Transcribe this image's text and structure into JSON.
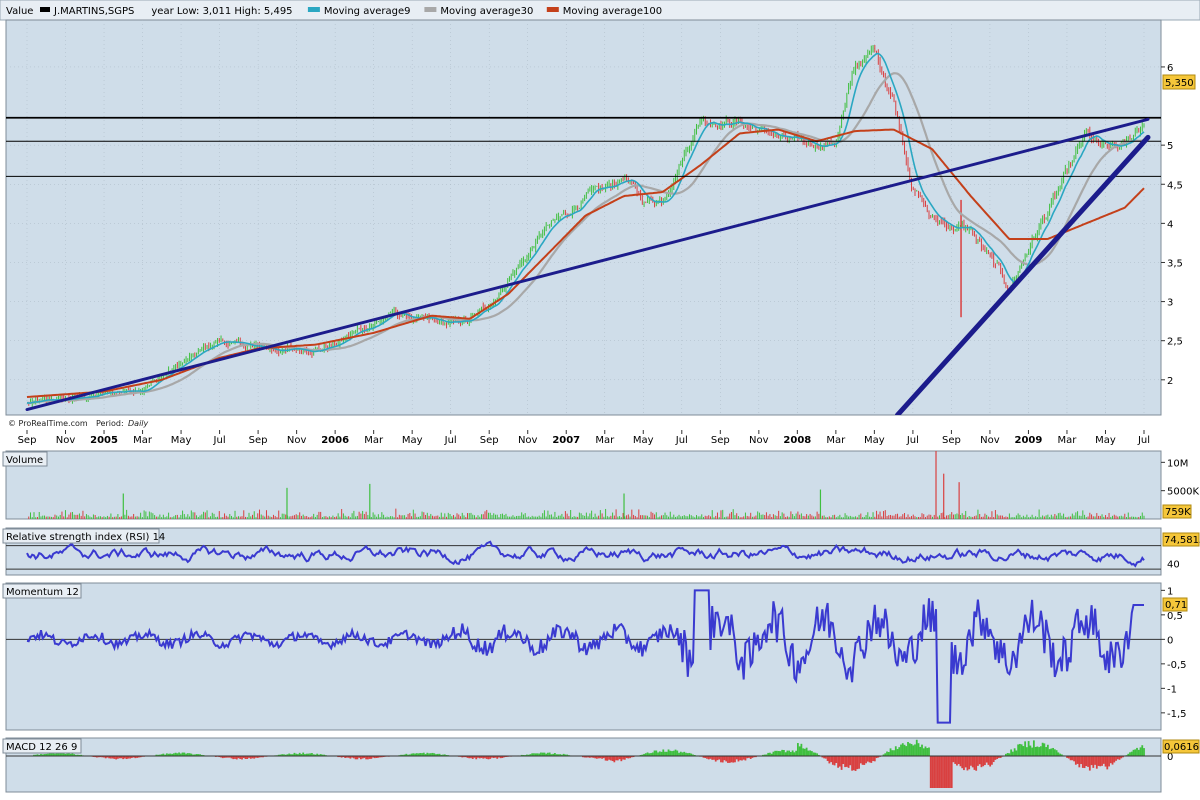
{
  "chart_data": {
    "type": "line",
    "header": {
      "value_label": "Value",
      "symbol": "J.MARTINS,SGPS",
      "range_text": "year Low: 3,011 High: 5,495",
      "legend": [
        {
          "name": "J.MARTINS,SGPS",
          "color": "#000000"
        },
        {
          "name": "Moving average9",
          "color": "#2aa7c2"
        },
        {
          "name": "Moving average30",
          "color": "#a8a8a8"
        },
        {
          "name": "Moving average100",
          "color": "#c4401a"
        }
      ]
    },
    "credit": "© ProRealTime.com",
    "period_label": "Period:",
    "period_value": "Daily",
    "x_ticks": [
      {
        "label": "Sep",
        "bold": false
      },
      {
        "label": "Nov",
        "bold": false
      },
      {
        "label": "2005",
        "bold": true
      },
      {
        "label": "Mar",
        "bold": false
      },
      {
        "label": "May",
        "bold": false
      },
      {
        "label": "Jul",
        "bold": false
      },
      {
        "label": "Sep",
        "bold": false
      },
      {
        "label": "Nov",
        "bold": false
      },
      {
        "label": "2006",
        "bold": true
      },
      {
        "label": "Mar",
        "bold": false
      },
      {
        "label": "May",
        "bold": false
      },
      {
        "label": "Jul",
        "bold": false
      },
      {
        "label": "Sep",
        "bold": false
      },
      {
        "label": "Nov",
        "bold": false
      },
      {
        "label": "2007",
        "bold": true
      },
      {
        "label": "Mar",
        "bold": false
      },
      {
        "label": "May",
        "bold": false
      },
      {
        "label": "Jul",
        "bold": false
      },
      {
        "label": "Sep",
        "bold": false
      },
      {
        "label": "Nov",
        "bold": false
      },
      {
        "label": "2008",
        "bold": true
      },
      {
        "label": "Mar",
        "bold": false
      },
      {
        "label": "May",
        "bold": false
      },
      {
        "label": "Jul",
        "bold": false
      },
      {
        "label": "Sep",
        "bold": false
      },
      {
        "label": "Nov",
        "bold": false
      },
      {
        "label": "2009",
        "bold": true
      },
      {
        "label": "Mar",
        "bold": false
      },
      {
        "label": "May",
        "bold": false
      },
      {
        "label": "Jul",
        "bold": false
      }
    ],
    "price_panel": {
      "ylim": [
        1.55,
        6.6
      ],
      "y_ticks": [
        {
          "v": 2,
          "label": "2"
        },
        {
          "v": 2.5,
          "label": "2,5"
        },
        {
          "v": 3,
          "label": "3"
        },
        {
          "v": 3.5,
          "label": "3,5"
        },
        {
          "v": 4,
          "label": "4"
        },
        {
          "v": 4.5,
          "label": "4,5"
        },
        {
          "v": 5,
          "label": "5"
        },
        {
          "v": 6,
          "label": "6"
        }
      ],
      "last_value_label": "5,350",
      "last_value": 5.35,
      "horizontal_lines": [
        5.35,
        5.05,
        4.6
      ],
      "price_anchors": [
        [
          0,
          1.7
        ],
        [
          2,
          1.74
        ],
        [
          4,
          1.82
        ],
        [
          6,
          1.9
        ],
        [
          8,
          2.2
        ],
        [
          10,
          2.5
        ],
        [
          11,
          2.45
        ],
        [
          12,
          2.4
        ],
        [
          14,
          2.38
        ],
        [
          16,
          2.45
        ],
        [
          17,
          2.6
        ],
        [
          19,
          2.85
        ],
        [
          21,
          2.72
        ],
        [
          22,
          2.7
        ],
        [
          23,
          2.75
        ],
        [
          24,
          2.95
        ],
        [
          25,
          3.3
        ],
        [
          26,
          3.6
        ],
        [
          27,
          3.95
        ],
        [
          28,
          4.1
        ],
        [
          29,
          4.35
        ],
        [
          30,
          4.4
        ],
        [
          31,
          4.6
        ],
        [
          32,
          4.28
        ],
        [
          33,
          4.3
        ],
        [
          34,
          4.85
        ],
        [
          35,
          5.35
        ],
        [
          37,
          5.3
        ],
        [
          38,
          5.2
        ],
        [
          40,
          5.0
        ],
        [
          42,
          5.05
        ],
        [
          43,
          6.0
        ],
        [
          44,
          6.2
        ],
        [
          45,
          5.6
        ],
        [
          46,
          4.5
        ],
        [
          47,
          4.05
        ],
        [
          49,
          3.9
        ],
        [
          51,
          3.15
        ],
        [
          52,
          3.7
        ],
        [
          54,
          4.6
        ],
        [
          55,
          5.1
        ],
        [
          56,
          4.9
        ],
        [
          57,
          4.95
        ],
        [
          58,
          5.3
        ]
      ],
      "ma100_anchors": [
        [
          0,
          1.78
        ],
        [
          4,
          1.85
        ],
        [
          7,
          2.0
        ],
        [
          10,
          2.28
        ],
        [
          12,
          2.4
        ],
        [
          15,
          2.45
        ],
        [
          18,
          2.6
        ],
        [
          21,
          2.82
        ],
        [
          23,
          2.78
        ],
        [
          25,
          3.1
        ],
        [
          27,
          3.6
        ],
        [
          29,
          4.1
        ],
        [
          31,
          4.35
        ],
        [
          33,
          4.4
        ],
        [
          35,
          4.75
        ],
        [
          37,
          5.15
        ],
        [
          39,
          5.2
        ],
        [
          41,
          5.05
        ],
        [
          43,
          5.18
        ],
        [
          45,
          5.2
        ],
        [
          47,
          4.95
        ],
        [
          49,
          4.35
        ],
        [
          51,
          3.8
        ],
        [
          53,
          3.8
        ],
        [
          55,
          4.0
        ],
        [
          57,
          4.2
        ],
        [
          58,
          4.45
        ]
      ],
      "trendlines": [
        {
          "name": "trendline-long",
          "from": [
            0,
            1.62
          ],
          "to": [
            58,
            5.33
          ],
          "width": 3
        },
        {
          "name": "trendline-steep",
          "from": [
            45.2,
            1.55
          ],
          "to": [
            58,
            5.1
          ],
          "width": 5
        }
      ],
      "volatility_spike": {
        "x": 48.5,
        "low": 2.8
      }
    },
    "volume_panel": {
      "title": "Volume",
      "y_ticks": [
        {
          "v": 10000000,
          "label": "10M"
        },
        {
          "v": 5000000,
          "label": "5000K"
        }
      ],
      "last_value_label": "759K",
      "ymax": 12000000,
      "spikes": [
        [
          5,
          4500000
        ],
        [
          13.5,
          5500000
        ],
        [
          17.8,
          6200000
        ],
        [
          31,
          4500000
        ],
        [
          41.2,
          5200000
        ],
        [
          47.2,
          12000000
        ],
        [
          47.6,
          8000000
        ],
        [
          48.4,
          6500000
        ]
      ]
    },
    "rsi_panel": {
      "title": "Relative strength index (RSI) 14",
      "ylim": [
        20,
        100
      ],
      "y_ticks": [
        {
          "v": 40,
          "label": "40"
        }
      ],
      "levels": [
        70,
        30
      ],
      "last_value_label": "74,5815"
    },
    "momentum_panel": {
      "title": "Momentum 12",
      "ylim": [
        -1.85,
        1.15
      ],
      "y_ticks": [
        {
          "v": 1,
          "label": "1"
        },
        {
          "v": 0.5,
          "label": "0,5"
        },
        {
          "v": 0,
          "label": "0"
        },
        {
          "v": -0.5,
          "label": "-0,5"
        },
        {
          "v": -1,
          "label": "-1"
        },
        {
          "v": -1.5,
          "label": "-1,5"
        }
      ],
      "last_value_label": "0,71"
    },
    "macd_panel": {
      "title": "MACD 12 26 9",
      "y_ticks": [
        {
          "v": 0,
          "label": "0"
        }
      ],
      "last_value_label": "0,0616"
    },
    "colors": {
      "panel_bg": "#cfdde9",
      "grid": "#aab8c4",
      "price_up": "#3fbf3f",
      "price_down": "#d94040",
      "ma9": "#2aa7c2",
      "ma30": "#a8a8a8",
      "ma100": "#c4401a",
      "trendline": "#1c1c8c",
      "indicator_line": "#3a3ad0",
      "label_bg": "#f5c63a",
      "title_bg": "#e8eef4"
    }
  }
}
